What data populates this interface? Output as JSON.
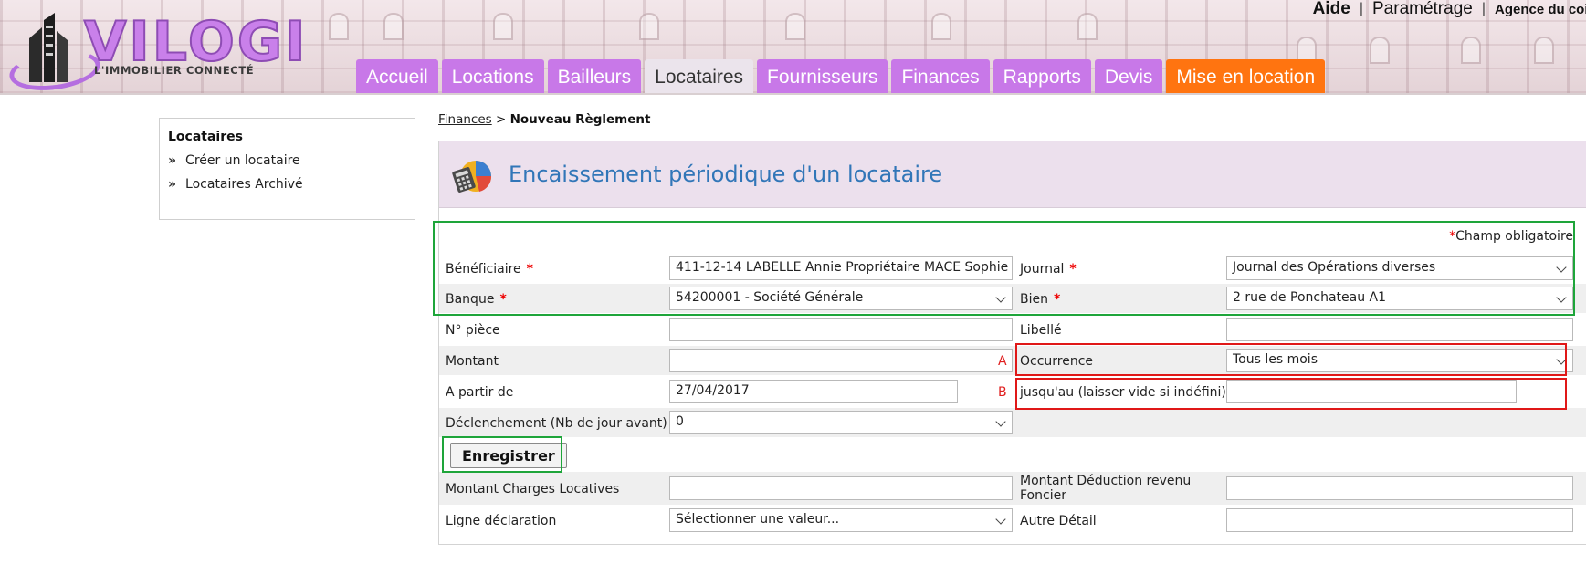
{
  "header": {
    "logo_word": "VILOGI",
    "logo_tagline": "L'IMMOBILIER CONNECTÉ",
    "toplinks": {
      "aide": "Aide",
      "parametrage": "Paramétrage",
      "agence": "Agence du coi",
      "separator": "|"
    },
    "nav": [
      {
        "label": "Accueil"
      },
      {
        "label": "Locations"
      },
      {
        "label": "Bailleurs"
      },
      {
        "label": "Locataires",
        "active": true
      },
      {
        "label": "Fournisseurs"
      },
      {
        "label": "Finances"
      },
      {
        "label": "Rapports"
      },
      {
        "label": "Devis"
      },
      {
        "label": "Mise en location",
        "accent": "#ff7410"
      }
    ]
  },
  "sidebar": {
    "title": "Locataires",
    "items": [
      {
        "label": "Créer un locataire"
      },
      {
        "label": "Locataires Archivé"
      }
    ]
  },
  "breadcrumb": {
    "parent": "Finances",
    "separator": ">",
    "current": "Nouveau Règlement"
  },
  "panel": {
    "title": "Encaissement périodique d'un locataire",
    "required_star": "*",
    "required_note": "Champ obligatoire"
  },
  "form": {
    "beneficiaire": {
      "label": "Bénéficiaire",
      "value": "411-12-14 LABELLE Annie Propriétaire MACE Sophie"
    },
    "journal": {
      "label": "Journal",
      "value": "Journal des Opérations diverses"
    },
    "banque": {
      "label": "Banque",
      "value": "54200001 - Société Générale"
    },
    "bien": {
      "label": "Bien",
      "value": "2 rue de Ponchateau A1"
    },
    "num_piece": {
      "label": "N° pièce",
      "value": ""
    },
    "libelle": {
      "label": "Libellé",
      "value": ""
    },
    "montant": {
      "label": "Montant",
      "value": "",
      "marker": "A"
    },
    "occurrence": {
      "label": "Occurrence",
      "value": "Tous les mois"
    },
    "a_partir_de": {
      "label": "A partir de",
      "value": "27/04/2017",
      "marker": "B"
    },
    "jusquau": {
      "label": "jusqu'au (laisser vide si indéfini)",
      "value": ""
    },
    "declenchement": {
      "label": "Déclenchement (Nb de jour avant)",
      "value": "0"
    },
    "save_label": "Enregistrer",
    "charges": {
      "label": "Montant Charges Locatives",
      "value": ""
    },
    "deduction": {
      "label": "Montant Déduction revenu Foncier",
      "value": ""
    },
    "ligne_declaration": {
      "label": "Ligne déclaration",
      "value": "Sélectionner une valeur..."
    },
    "autre_detail": {
      "label": "Autre Détail",
      "value": ""
    }
  },
  "colors": {
    "nav_tab": "#c878e8",
    "nav_active": "#ebe4ec",
    "nav_accent": "#ff7410",
    "title_blue": "#3176b8",
    "highlight_green": "#1ea53a",
    "highlight_red": "#e01818",
    "required": "#e00000"
  }
}
